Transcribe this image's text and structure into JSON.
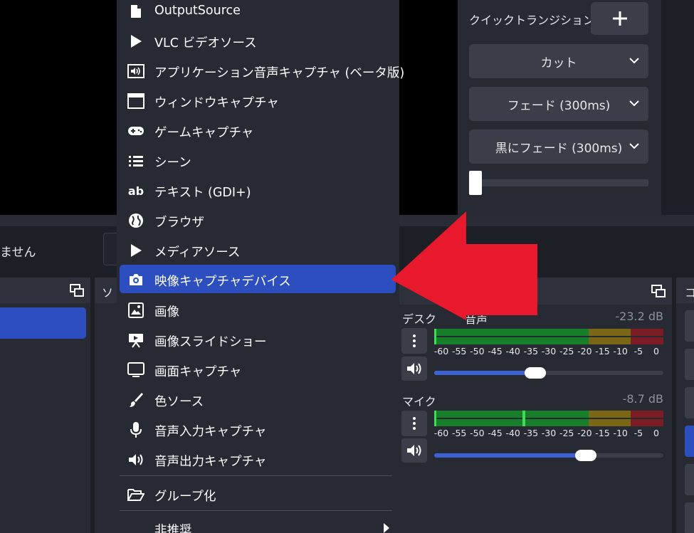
{
  "transitions": {
    "quick_label": "クイックトランジション",
    "add_symbol": "+",
    "items": [
      "カット",
      "フェード (300ms)",
      "黒にフェード (300ms)"
    ]
  },
  "controls": {
    "status_text": "ません"
  },
  "sources_dock": {
    "title_partial": "ソ"
  },
  "controls_dock": {
    "title_partial": "コ"
  },
  "menu": {
    "items": [
      {
        "label": "OutputSource",
        "icon": "file-icon"
      },
      {
        "label": "VLC ビデオソース",
        "icon": "play-icon"
      },
      {
        "label": "アプリケーション音声キャプチャ (ベータ版)",
        "icon": "app-audio-icon"
      },
      {
        "label": "ウィンドウキャプチャ",
        "icon": "window-icon"
      },
      {
        "label": "ゲームキャプチャ",
        "icon": "gamepad-icon"
      },
      {
        "label": "シーン",
        "icon": "list-icon"
      },
      {
        "label": "テキスト (GDI+)",
        "icon": "text-icon"
      },
      {
        "label": "ブラウザ",
        "icon": "globe-icon"
      },
      {
        "label": "メディアソース",
        "icon": "play-icon"
      },
      {
        "label": "映像キャプチャデバイス",
        "icon": "camera-icon",
        "selected": true
      },
      {
        "label": "画像",
        "icon": "image-icon"
      },
      {
        "label": "画像スライドショー",
        "icon": "slideshow-icon"
      },
      {
        "label": "画面キャプチャ",
        "icon": "monitor-icon"
      },
      {
        "label": "色ソース",
        "icon": "brush-icon"
      },
      {
        "label": "音声入力キャプチャ",
        "icon": "microphone-icon"
      },
      {
        "label": "音声出力キャプチャ",
        "icon": "speaker-icon"
      }
    ],
    "group_label": "グループ化",
    "deprecated_label": "非推奨"
  },
  "mixer": {
    "channels": [
      {
        "name": "デスクトップ音声",
        "name_visible": "デスク",
        "name_visible_tail": "音声",
        "db": "-23.2 dB",
        "volume_fraction": 0.44
      },
      {
        "name": "マイク",
        "name_visible": "マイク",
        "db": "-8.7 dB",
        "volume_fraction": 0.66,
        "peak_db": -37
      }
    ],
    "ticks": [
      "-60",
      "-55",
      "-50",
      "-45",
      "-40",
      "-35",
      "-30",
      "-25",
      "-20",
      "-15",
      "-10",
      "-5",
      "0"
    ]
  },
  "colors": {
    "accent": "#2c4ebf",
    "arrow": "#e8192c",
    "meter_green": "#177e2a",
    "meter_yellow": "#7a6716",
    "meter_red": "#7c1c25"
  }
}
